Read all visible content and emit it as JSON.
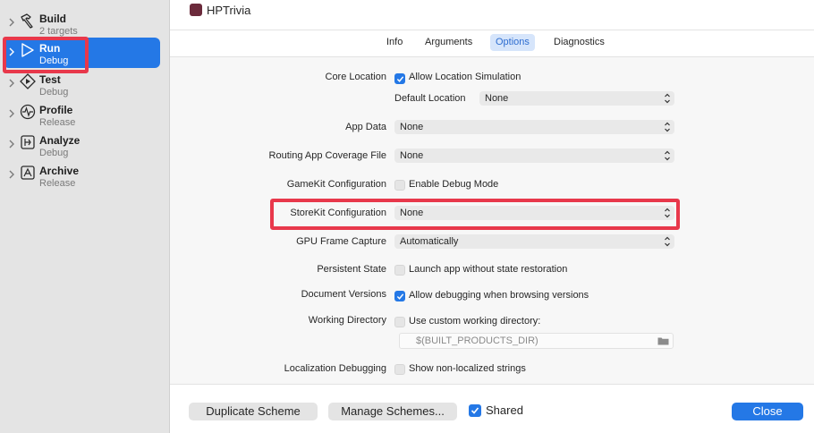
{
  "sidebar": {
    "actions": [
      {
        "name": "Build",
        "sub": "2 targets",
        "icon": "hammer-icon"
      },
      {
        "name": "Run",
        "sub": "Debug",
        "icon": "play-icon"
      },
      {
        "name": "Test",
        "sub": "Debug",
        "icon": "test-diamond-icon"
      },
      {
        "name": "Profile",
        "sub": "Release",
        "icon": "gauge-icon"
      },
      {
        "name": "Analyze",
        "sub": "Debug",
        "icon": "analyze-icon"
      },
      {
        "name": "Archive",
        "sub": "Release",
        "icon": "archive-icon"
      }
    ],
    "selected": "Run"
  },
  "header": {
    "title": "HPTrivia"
  },
  "tabs": [
    "Info",
    "Arguments",
    "Options",
    "Diagnostics"
  ],
  "active_tab": "Options",
  "options": {
    "core_location": {
      "label": "Core Location",
      "checkbox_text": "Allow Location Simulation",
      "checked": true
    },
    "default_location": {
      "label": "Default Location",
      "value": "None"
    },
    "app_data": {
      "label": "App Data",
      "value": "None"
    },
    "routing": {
      "label": "Routing App Coverage File",
      "value": "None"
    },
    "gamekit": {
      "label": "GameKit Configuration",
      "checkbox_text": "Enable Debug Mode",
      "checked": false
    },
    "storekit": {
      "label": "StoreKit Configuration",
      "value": "None"
    },
    "gpu": {
      "label": "GPU Frame Capture",
      "value": "Automatically"
    },
    "persistent": {
      "label": "Persistent State",
      "checkbox_text": "Launch app without state restoration",
      "checked": false
    },
    "docversions": {
      "label": "Document Versions",
      "checkbox_text": "Allow debugging when browsing versions",
      "checked": true
    },
    "workdir": {
      "label": "Working Directory",
      "checkbox_text": "Use custom working directory:",
      "checked": false,
      "placeholder": "$(BUILT_PRODUCTS_DIR)"
    },
    "localization": {
      "label": "Localization Debugging",
      "checkbox_text": "Show non-localized strings",
      "checked": false
    }
  },
  "footer": {
    "duplicate": "Duplicate Scheme",
    "manage": "Manage Schemes...",
    "shared_label": "Shared",
    "shared_checked": true,
    "close": "Close"
  },
  "colors": {
    "accent": "#2478e6",
    "highlight": "#e8384b",
    "sidebar_bg": "#e4e4e4",
    "content_bg": "#f7f7f7"
  }
}
